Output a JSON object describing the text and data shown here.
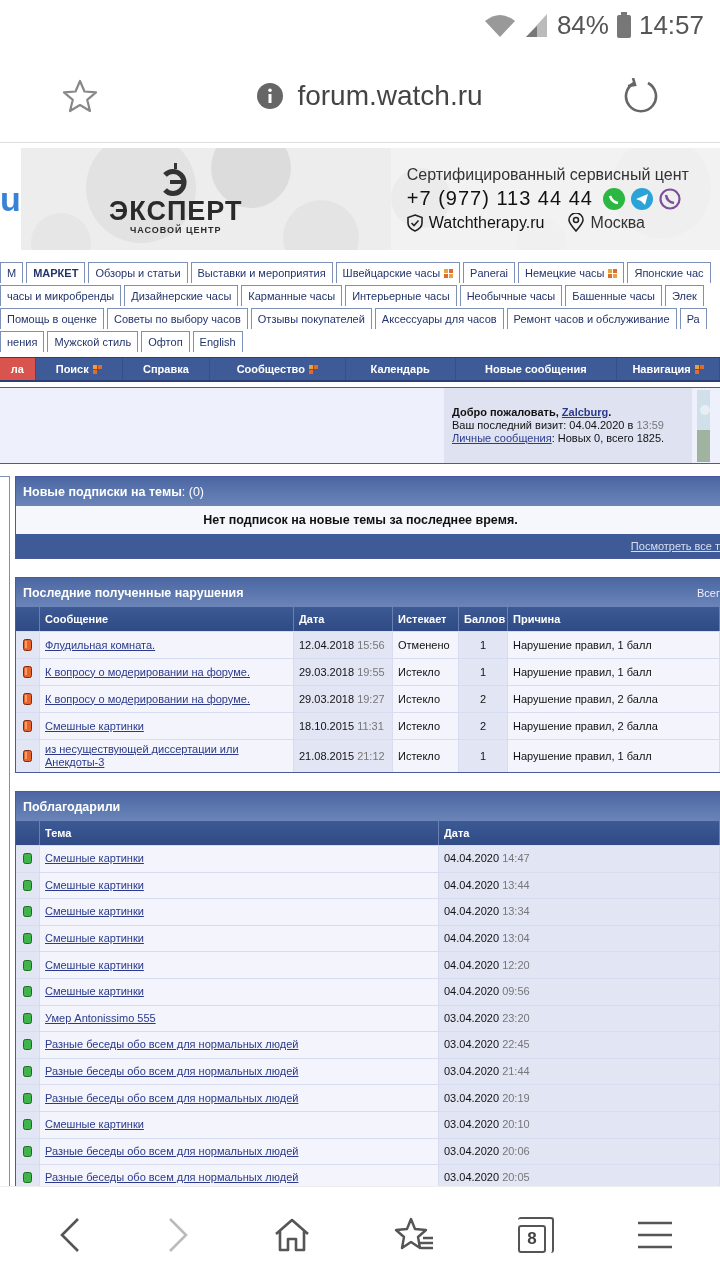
{
  "status_bar": {
    "battery": "84%",
    "time": "14:57"
  },
  "browser": {
    "url": "forum.watch.ru",
    "tab_count": "8",
    "forward_disabled": true
  },
  "banner": {
    "cut_logo": "u",
    "brand": "ЭКСПЕРТ",
    "subtitle": "ЧАСОВОЙ ЦЕНТР",
    "tagline": "Сертифицированный сервисный цент",
    "phone": "+7 (977) 113 44 44",
    "site": "Watchtherapy.ru",
    "city": "Москва"
  },
  "tab_rows": [
    {
      "tabs": [
        {
          "label": "М",
          "selected": false,
          "menu": false
        },
        {
          "label": "МАРКЕТ",
          "selected": true,
          "menu": false
        },
        {
          "label": "Обзоры и статьи",
          "selected": false,
          "menu": false
        },
        {
          "label": "Выставки и мероприятия",
          "selected": false,
          "menu": false
        },
        {
          "label": "Швейцарские часы",
          "selected": false,
          "menu": true
        },
        {
          "label": "Panerai",
          "selected": false,
          "menu": false
        },
        {
          "label": "Немецкие часы",
          "selected": false,
          "menu": true
        },
        {
          "label": "Японские час",
          "selected": false,
          "menu": false
        }
      ]
    },
    {
      "tabs": [
        {
          "label": "часы и микробренды",
          "selected": false,
          "menu": false
        },
        {
          "label": "Дизайнерские часы",
          "selected": false,
          "menu": false
        },
        {
          "label": "Карманные часы",
          "selected": false,
          "menu": false
        },
        {
          "label": "Интерьерные часы",
          "selected": false,
          "menu": false
        },
        {
          "label": "Необычные часы",
          "selected": false,
          "menu": false
        },
        {
          "label": "Башенные часы",
          "selected": false,
          "menu": false
        },
        {
          "label": "Элек",
          "selected": false,
          "menu": false
        }
      ]
    },
    {
      "tabs": [
        {
          "label": "Помощь в оценке",
          "selected": false,
          "menu": false
        },
        {
          "label": "Советы по выбору часов",
          "selected": false,
          "menu": false
        },
        {
          "label": "Отзывы покупателей",
          "selected": false,
          "menu": false
        },
        {
          "label": "Аксессуары для часов",
          "selected": false,
          "menu": false
        },
        {
          "label": "Ремонт часов и обслуживание",
          "selected": false,
          "menu": false
        },
        {
          "label": "Ра",
          "selected": false,
          "menu": false
        }
      ]
    },
    {
      "tabs": [
        {
          "label": "нения",
          "selected": false,
          "menu": false
        },
        {
          "label": "Мужской стиль",
          "selected": false,
          "menu": false
        },
        {
          "label": "Офтоп",
          "selected": false,
          "menu": false
        },
        {
          "label": "English",
          "selected": false,
          "menu": false
        }
      ]
    }
  ],
  "nav_bar": [
    {
      "label": "ла",
      "kind": "highlight",
      "menu": false
    },
    {
      "label": "Поиск",
      "kind": "normal",
      "menu": true
    },
    {
      "label": "Справка",
      "kind": "normal",
      "menu": false
    },
    {
      "label": "Сообщество",
      "kind": "normal",
      "menu": true
    },
    {
      "label": "Календарь",
      "kind": "normal",
      "menu": false
    },
    {
      "label": "Новые сообщения",
      "kind": "normal",
      "menu": false
    },
    {
      "label": "Навигация",
      "kind": "normal",
      "menu": true
    }
  ],
  "welcome": {
    "greeting": "Добро пожаловать, ",
    "user": "Zalcburg",
    "greeting_end": ".",
    "last_visit": "Ваш последний визит: 04.04.2020 в ",
    "last_visit_time": "13:59",
    "pm_link": "Личные сообщения",
    "pm_text": ": Новых 0, всего 1825."
  },
  "subscriptions": {
    "title": "Новые подписки на темы",
    "count": ": (0)",
    "empty_text": "Нет подписок на новые темы за последнее время.",
    "footer_link": "Посмотреть все т"
  },
  "violations": {
    "title": "Последние полученные нарушения",
    "side_link": "Всег",
    "columns": [
      "Сообщение",
      "Дата",
      "Истекает",
      "Баллов",
      "Причина"
    ],
    "rows": [
      {
        "message": "Флудильная комната.",
        "date": "12.04.2018",
        "time": "15:56",
        "expires": "Отменено",
        "points": "1",
        "reason": "Нарушение правил, 1 балл"
      },
      {
        "message": "К вопросу о модерировании на форуме.",
        "date": "29.03.2018",
        "time": "19:55",
        "expires": "Истекло",
        "points": "1",
        "reason": "Нарушение правил, 1 балл"
      },
      {
        "message": "К вопросу о модерировании на форуме.",
        "date": "29.03.2018",
        "time": "19:27",
        "expires": "Истекло",
        "points": "2",
        "reason": "Нарушение правил, 2 балла"
      },
      {
        "message": "Смешные картинки",
        "date": "18.10.2015",
        "time": "11:31",
        "expires": "Истекло",
        "points": "2",
        "reason": "Нарушение правил, 2 балла"
      },
      {
        "message": "из несуществующей диссертации или Анекдоты-3",
        "date": "21.08.2015",
        "time": "21:12",
        "expires": "Истекло",
        "points": "1",
        "reason": "Нарушение правил, 1 балл"
      }
    ]
  },
  "thanks": {
    "title": "Поблагодарили",
    "columns": [
      "Тема",
      "Дата"
    ],
    "rows": [
      {
        "topic": "Смешные картинки",
        "date": "04.04.2020",
        "time": "14:47"
      },
      {
        "topic": "Смешные картинки",
        "date": "04.04.2020",
        "time": "13:44"
      },
      {
        "topic": "Смешные картинки",
        "date": "04.04.2020",
        "time": "13:34"
      },
      {
        "topic": "Смешные картинки",
        "date": "04.04.2020",
        "time": "13:04"
      },
      {
        "topic": "Смешные картинки",
        "date": "04.04.2020",
        "time": "12:20"
      },
      {
        "topic": "Смешные картинки",
        "date": "04.04.2020",
        "time": "09:56"
      },
      {
        "topic": "Умер Antonissimo 555",
        "date": "03.04.2020",
        "time": "23:20"
      },
      {
        "topic": "Разные беседы обо всем для нормальных людей",
        "date": "03.04.2020",
        "time": "22:45"
      },
      {
        "topic": "Разные беседы обо всем для нормальных людей",
        "date": "03.04.2020",
        "time": "21:44"
      },
      {
        "topic": "Разные беседы обо всем для нормальных людей",
        "date": "03.04.2020",
        "time": "20:19"
      },
      {
        "topic": "Смешные картинки",
        "date": "03.04.2020",
        "time": "20:10"
      },
      {
        "topic": "Разные беседы обо всем для нормальных людей",
        "date": "03.04.2020",
        "time": "20:06"
      },
      {
        "topic": "Разные беседы обо всем для нормальных людей",
        "date": "03.04.2020",
        "time": "20:05"
      }
    ]
  }
}
